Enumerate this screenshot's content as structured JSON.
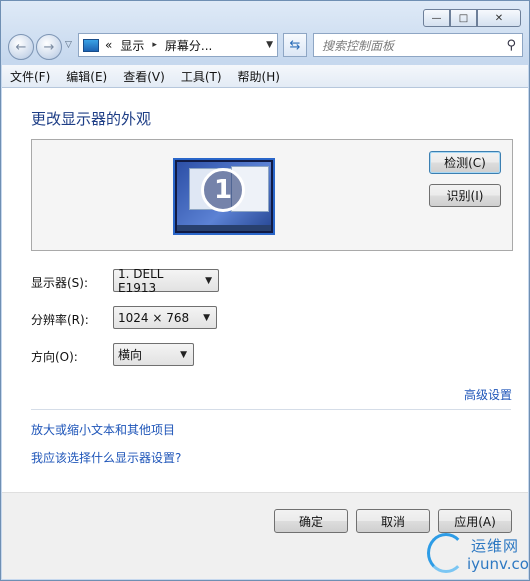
{
  "window": {
    "caption": {
      "min": "—",
      "max": "□",
      "close": "✕"
    }
  },
  "nav": {
    "address_prefix": "«",
    "crumb1": "显示",
    "crumb2": "屏幕分...",
    "search_placeholder": "搜索控制面板"
  },
  "menu": [
    "文件(F)",
    "编辑(E)",
    "查看(V)",
    "工具(T)",
    "帮助(H)"
  ],
  "main": {
    "title": "更改显示器的外观",
    "monitor_number": "1",
    "detect_label": "检测(C)",
    "identify_label": "识别(I)",
    "display_label": "显示器(S):",
    "display_value": "1. DELL E1913",
    "resolution_label": "分辨率(R):",
    "resolution_value": "1024 × 768",
    "orientation_label": "方向(O):",
    "orientation_value": "横向",
    "advanced_link": "高级设置",
    "link_text_size": "放大或缩小文本和其他项目",
    "link_which_settings": "我应该选择什么显示器设置?"
  },
  "footer": {
    "ok_label": "确定",
    "cancel_label": "取消",
    "apply_label": "应用(A)"
  },
  "watermark": {
    "cn": "运维网",
    "en": "iyunv.com"
  }
}
